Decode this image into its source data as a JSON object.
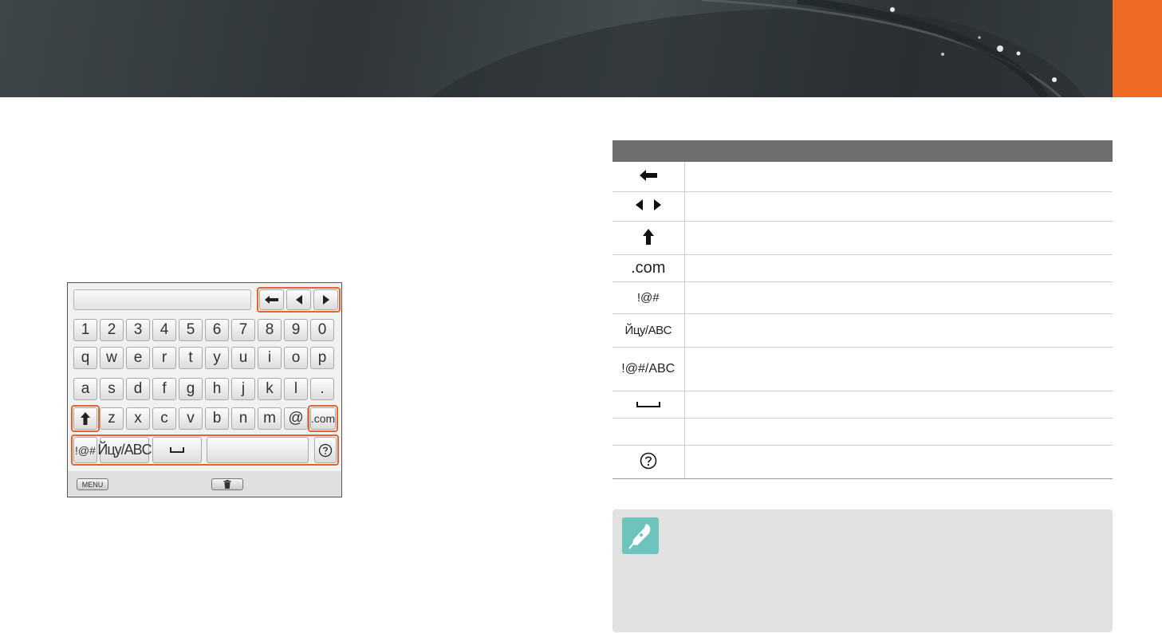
{
  "colors": {
    "accent": "#ee6a25",
    "highlight": "#e0652f",
    "note_icon": "#6ec4bd",
    "table_header": "#6e6e6e"
  },
  "keyboard": {
    "rows": [
      [
        "1",
        "2",
        "3",
        "4",
        "5",
        "6",
        "7",
        "8",
        "9",
        "0"
      ],
      [
        "q",
        "w",
        "e",
        "r",
        "t",
        "y",
        "u",
        "i",
        "o",
        "p"
      ],
      [
        "a",
        "s",
        "d",
        "f",
        "g",
        "h",
        "j",
        "k",
        "l",
        "."
      ],
      [
        "z",
        "x",
        "c",
        "v",
        "b",
        "n",
        "m",
        "@"
      ]
    ],
    "com_key": ".com",
    "symbols_key": "!@#",
    "lang_key": "Йцу/ABC",
    "menu_button": "MENU",
    "icons": {
      "backspace": "backspace-icon",
      "left": "arrow-left-icon",
      "right": "arrow-right-icon",
      "shift": "shift-up-icon",
      "space": "space-icon",
      "help": "help-icon",
      "trash": "trash-icon"
    }
  },
  "table": {
    "header": {
      "col1": "",
      "col2": ""
    },
    "rows": [
      {
        "icon": "backspace-icon",
        "label": ""
      },
      {
        "icon": "arrows-left-right-icon",
        "label": ""
      },
      {
        "icon": "shift-up-icon",
        "label": ""
      },
      {
        "icon": "",
        "label": ".com"
      },
      {
        "icon": "",
        "label": "!@#"
      },
      {
        "icon": "",
        "label": "Йцу/ABC"
      },
      {
        "icon": "",
        "label": "!@#/ABC"
      },
      {
        "icon": "space-icon",
        "label": ""
      },
      {
        "icon": "",
        "label": ""
      },
      {
        "icon": "help-icon",
        "label": ""
      }
    ]
  },
  "note": {
    "icon": "pen-note-icon"
  }
}
